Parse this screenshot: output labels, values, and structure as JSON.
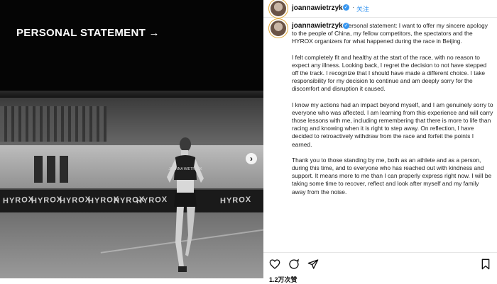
{
  "post": {
    "image": {
      "overlay_title": "PERSONAL STATEMENT →",
      "banner_text": [
        "HYROX",
        "HYROX",
        "HYROX",
        "HYROX",
        "HYROX",
        "HYROX",
        "HYROX"
      ],
      "bib_text": "JOANNA WIETRZYK"
    },
    "header": {
      "username": "joannawietrzyk",
      "verified_mark": "✓",
      "separator": "·",
      "follow_label": "关注"
    },
    "caption": {
      "username": "joannawietrzyk",
      "verified_mark": "✓",
      "paragraphs": [
        "Personal statement: I want to offer my sincere apology to the people of China, my fellow competitors, the spectators and the HYROX organizers for what happened during the race in Beijing.",
        "I felt completely fit and healthy at the start of the race, with no reason to expect any illness. Looking back, I regret the decision to not have stepped off the track. I recognize that I should have made a different choice. I take responsibility for my decision to continue and am deeply sorry for the discomfort and disruption it caused.",
        "I know my actions had an impact beyond myself, and I am genuinely sorry to everyone who was affected. I am learning from this experience and will carry those lessons with me, including remembering that there is more to life than racing and knowing when it is right to step away. On reflection, I have decided to retroactively withdraw from the race and forfeit the points I earned.",
        "Thank you to those standing by me, both as an athlete and as a person, during this time, and to everyone who has reached out with kindness and support. It means more to me than I can properly express right now. I will be taking some time to recover, reflect and look after myself and my family away from the noise."
      ]
    },
    "actions": {
      "icons": [
        "heart-icon",
        "comment-icon",
        "share-icon",
        "bookmark-icon"
      ],
      "likes_text": "1.2万次赞"
    }
  },
  "colors": {
    "accent": "#3897f0",
    "text": "#222222"
  }
}
